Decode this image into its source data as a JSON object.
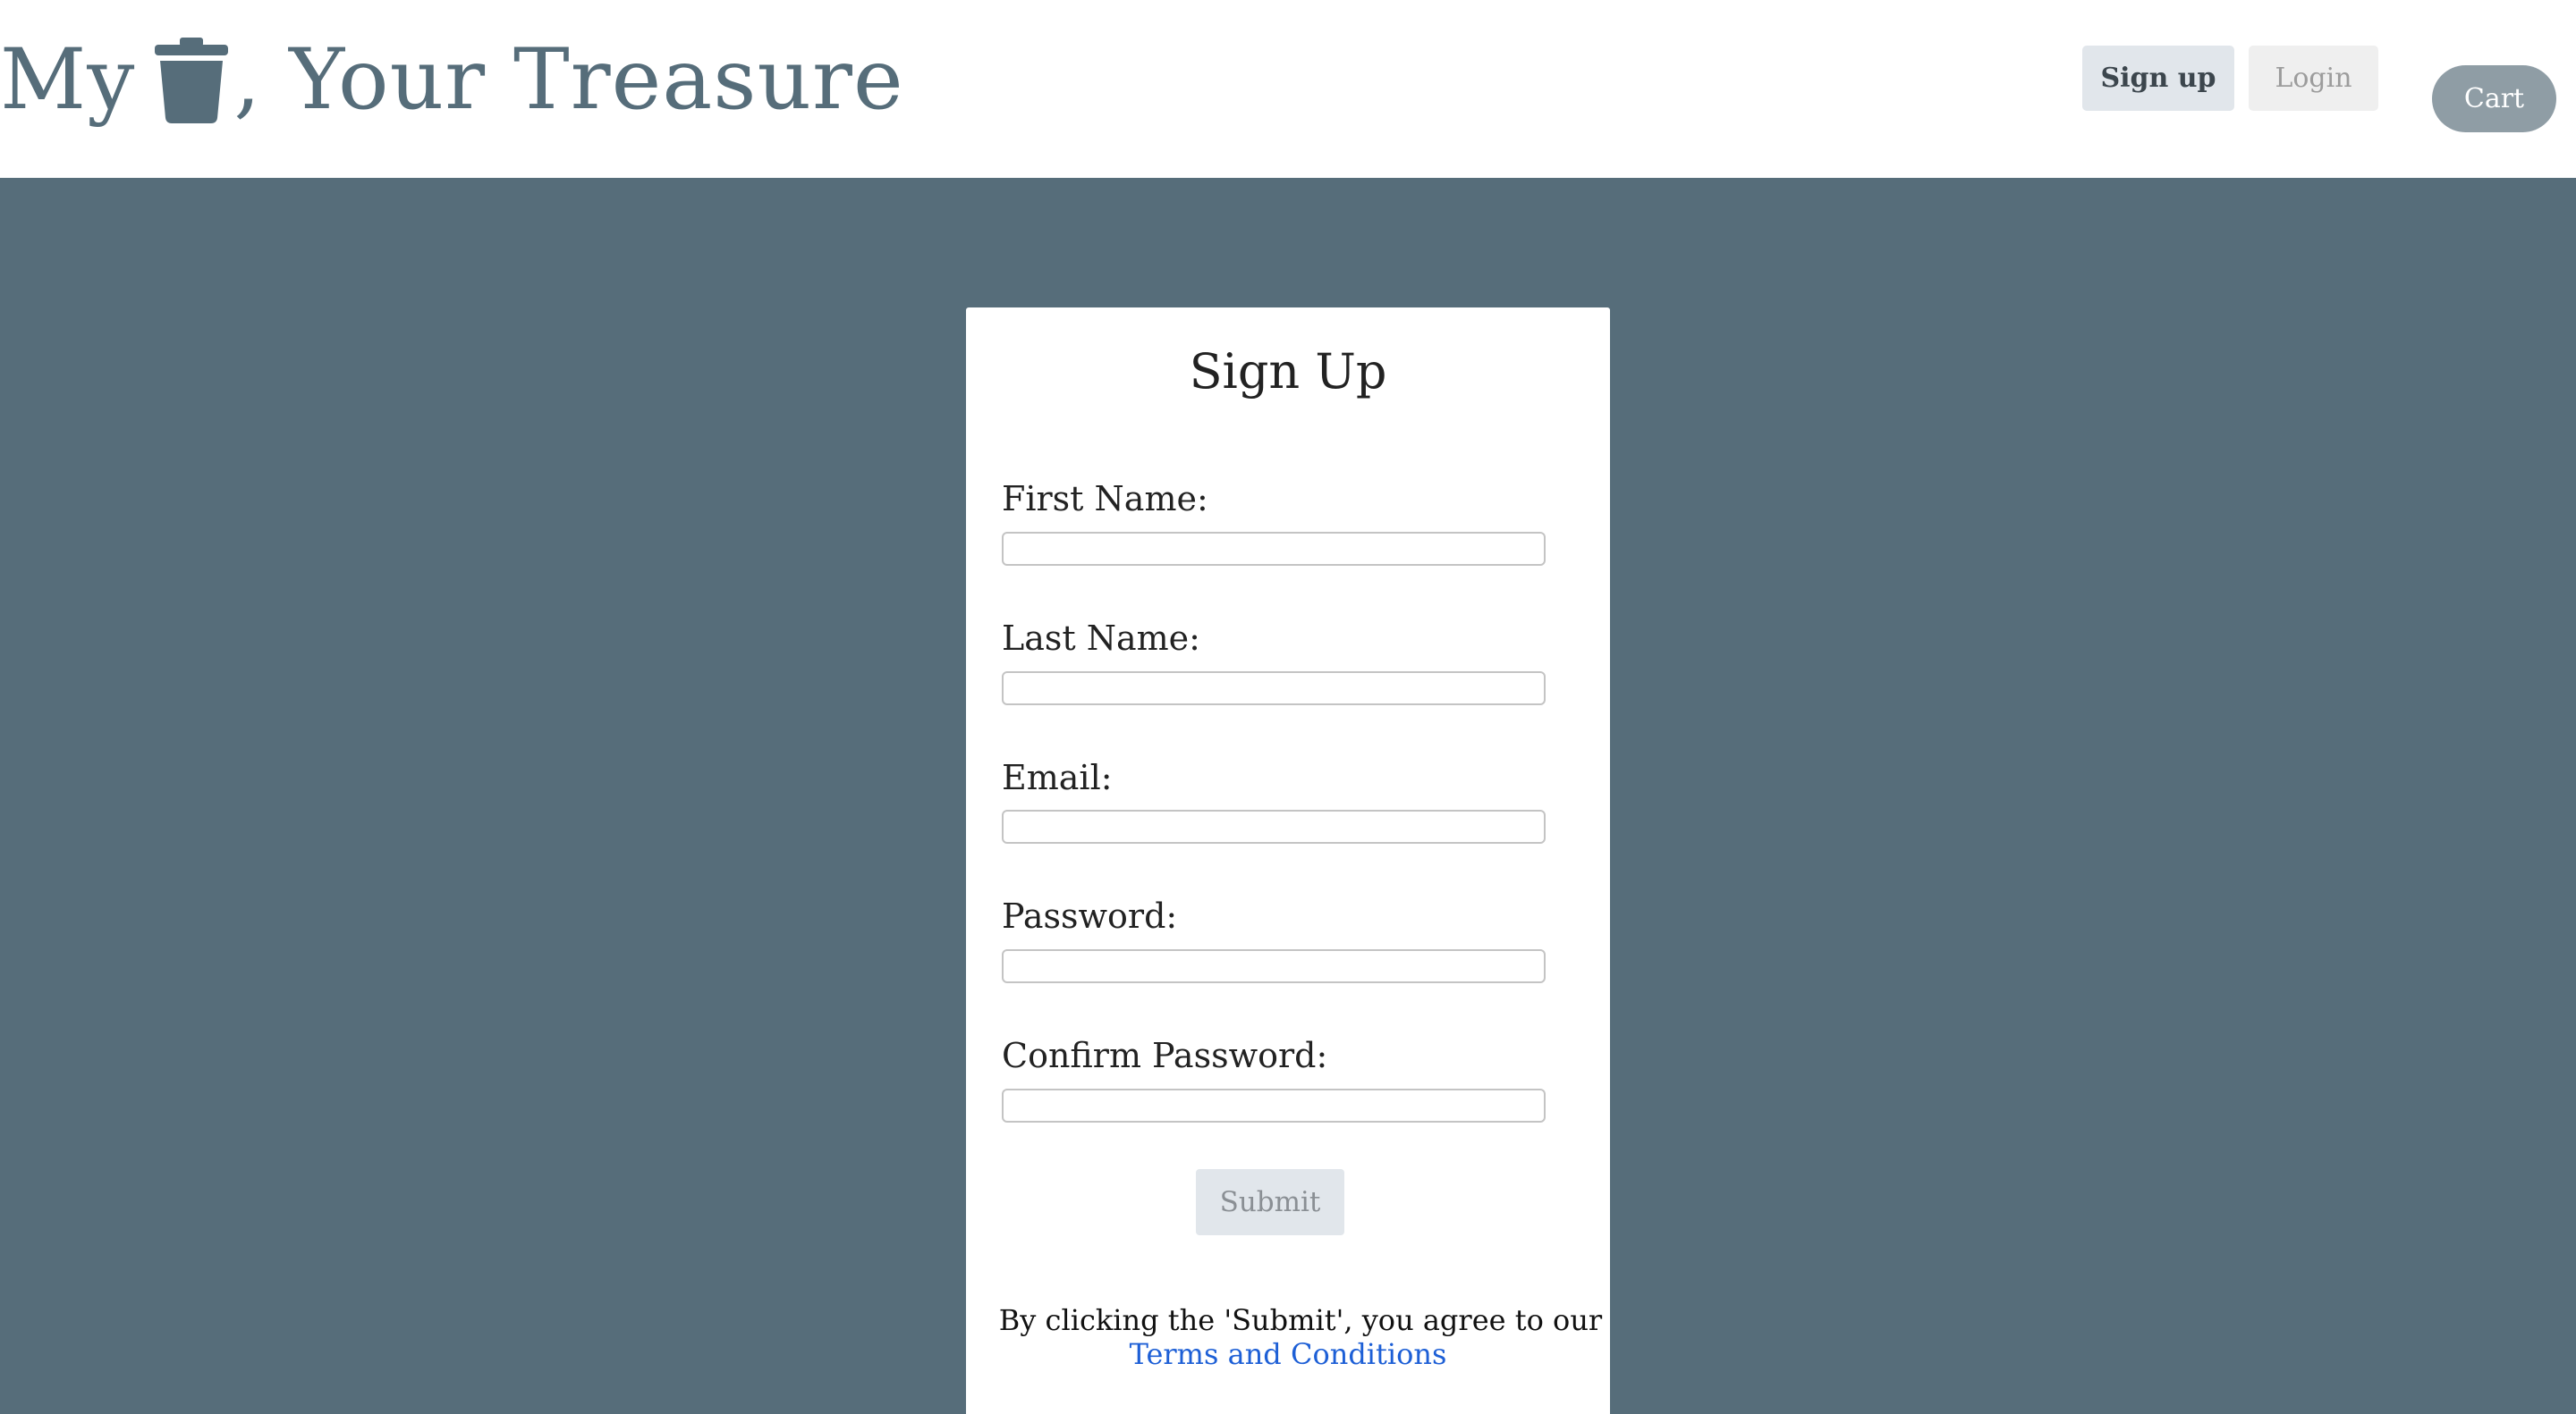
{
  "header": {
    "brand_prefix": "My",
    "brand_suffix": ", Your Treasure",
    "brand_icon": "trash-icon",
    "brand_color": "#566d7a",
    "nav": {
      "signup_label": "Sign up",
      "login_label": "Login",
      "cart_label": "Cart"
    }
  },
  "form": {
    "title": "Sign Up",
    "fields": [
      {
        "label": "First Name:",
        "value": ""
      },
      {
        "label": "Last Name:",
        "value": ""
      },
      {
        "label": "Email:",
        "value": ""
      },
      {
        "label": "Password:",
        "value": ""
      },
      {
        "label": "Confirm Password:",
        "value": ""
      }
    ],
    "submit_label": "Submit",
    "agreement_text": "By clicking the 'Submit', you agree to our",
    "terms_link": "Terms and Conditions"
  },
  "colors": {
    "page_background": "#566d7a",
    "link": "#1d5fd6",
    "cart_button": "#8f9da5"
  }
}
